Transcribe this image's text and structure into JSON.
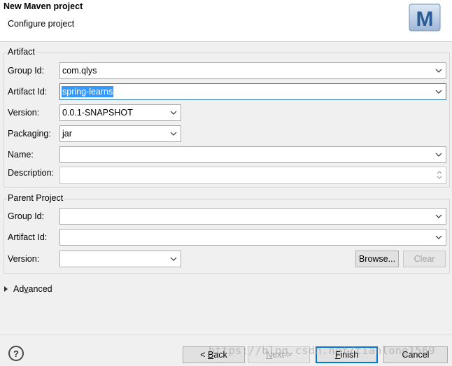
{
  "header": {
    "title": "New Maven project",
    "subtitle": "Configure project",
    "logo_letter": "M"
  },
  "artifact": {
    "title": "Artifact",
    "group_id": {
      "label": "Group Id:",
      "value": "com.qlys"
    },
    "artifact_id": {
      "label": "Artifact Id:",
      "value": "spring-learns"
    },
    "version": {
      "label": "Version:",
      "value": "0.0.1-SNAPSHOT"
    },
    "packaging": {
      "label": "Packaging:",
      "value": "jar"
    },
    "name": {
      "label": "Name:",
      "value": ""
    },
    "description": {
      "label": "Description:",
      "value": ""
    }
  },
  "parent": {
    "title": "Parent Project",
    "group_id": {
      "label": "Group Id:",
      "value": ""
    },
    "artifact_id": {
      "label": "Artifact Id:",
      "value": ""
    },
    "version": {
      "label": "Version:",
      "value": ""
    },
    "browse": "Browse...",
    "clear": "Clear"
  },
  "advanced": {
    "prefix": "Ad",
    "mnemonic": "v",
    "suffix": "anced"
  },
  "footer": {
    "back": {
      "prefix": "< ",
      "mnemonic": "B",
      "suffix": "ack"
    },
    "next": {
      "mnemonic": "N",
      "suffix": "ext >"
    },
    "finish": {
      "mnemonic": "F",
      "suffix": "inish"
    },
    "cancel": "Cancel",
    "help_glyph": "?"
  },
  "watermark": "https://blog.csdn.net/tianlong1569",
  "colors": {
    "selection": "#3399ff",
    "focus_border": "#3c7fb1",
    "default_button": "#0078d7"
  }
}
